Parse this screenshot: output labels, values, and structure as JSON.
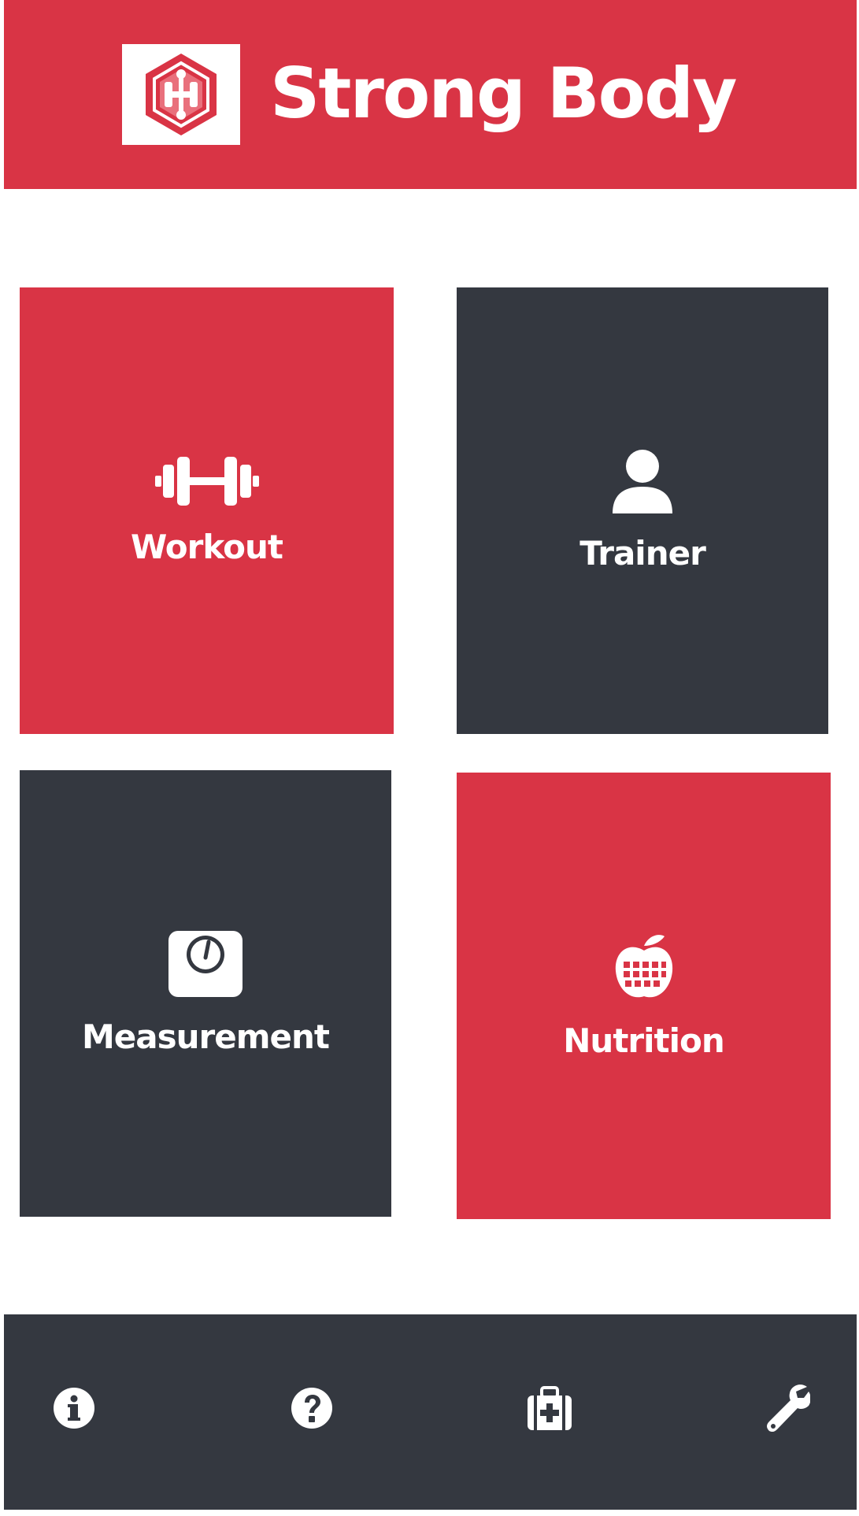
{
  "header": {
    "title": "Strong Body",
    "logo_icon": "dumbbell-hexagon-logo",
    "background": "#d93445"
  },
  "tiles": [
    {
      "label": "Workout",
      "icon": "dumbbell-icon",
      "color": "#d93445"
    },
    {
      "label": "Trainer",
      "icon": "user-icon",
      "color": "#343840"
    },
    {
      "label": "Measurement",
      "icon": "weight-scale-icon",
      "color": "#343840"
    },
    {
      "label": "Nutrition",
      "icon": "apple-calendar-icon",
      "color": "#d93445"
    }
  ],
  "bottom_nav": [
    {
      "icon": "info-icon"
    },
    {
      "icon": "help-icon"
    },
    {
      "icon": "medical-kit-icon"
    },
    {
      "icon": "wrench-icon"
    }
  ],
  "colors": {
    "accent": "#d93445",
    "dark": "#343840",
    "text": "#ffffff"
  }
}
